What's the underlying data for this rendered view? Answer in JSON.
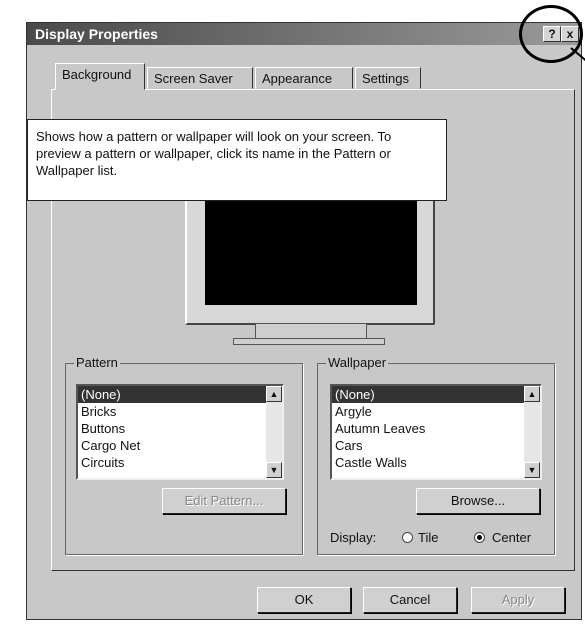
{
  "window": {
    "title": "Display Properties",
    "help_btn": "?",
    "close_btn": "x"
  },
  "tabs": [
    {
      "label": "Background",
      "active": true
    },
    {
      "label": "Screen Saver",
      "active": false
    },
    {
      "label": "Appearance",
      "active": false
    },
    {
      "label": "Settings",
      "active": false
    }
  ],
  "tooltip": {
    "text": "Shows how a pattern or wallpaper will look on your screen. To preview a pattern or wallpaper, click its name in the Pattern or Wallpaper list."
  },
  "pattern": {
    "label": "Pattern",
    "items": [
      "(None)",
      "Bricks",
      "Buttons",
      "Cargo Net",
      "Circuits"
    ],
    "selected": "(None)",
    "edit_button": "Edit Pattern..."
  },
  "wallpaper": {
    "label": "Wallpaper",
    "items": [
      "(None)",
      "Argyle",
      "Autumn Leaves",
      "Cars",
      "Castle Walls"
    ],
    "selected": "(None)",
    "browse_button": "Browse...",
    "display_label": "Display:",
    "tile_label": "Tile",
    "center_label": "Center",
    "display_mode": "Center"
  },
  "footer": {
    "ok": "OK",
    "cancel": "Cancel",
    "apply": "Apply"
  }
}
